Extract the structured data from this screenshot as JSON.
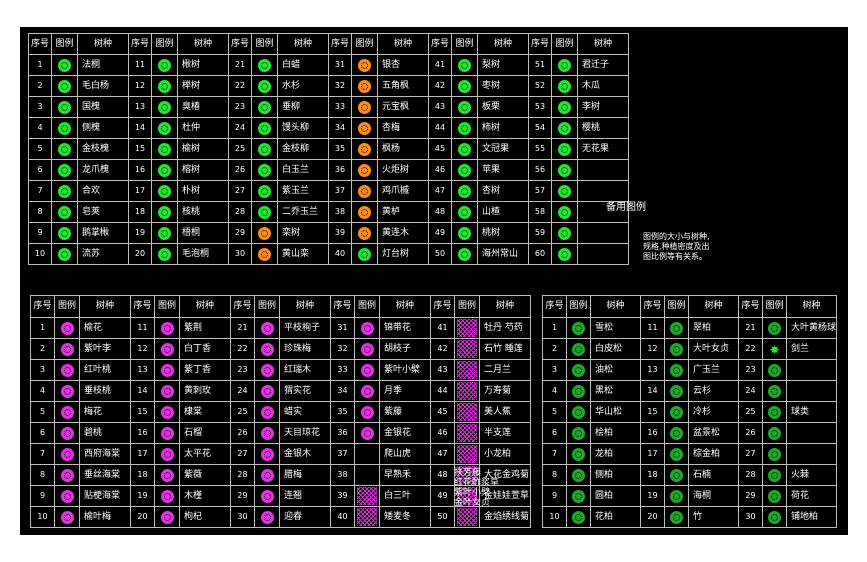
{
  "table1": {
    "headers": [
      "序号",
      "图例",
      "树种",
      "序号",
      "图例",
      "树种",
      "序号",
      "图例",
      "树种",
      "序号",
      "图例",
      "树种",
      "序号",
      "图例",
      "树种",
      "序号",
      "图例",
      "树种"
    ],
    "rows": [
      [
        "1",
        "g",
        "法桐",
        "11",
        "g",
        "楸树",
        "21",
        "g",
        "白蜡",
        "31",
        "o",
        "银杏",
        "41",
        "g",
        "梨树",
        "51",
        "g",
        "君迁子"
      ],
      [
        "2",
        "g",
        "毛白杨",
        "12",
        "g",
        "榉树",
        "22",
        "g",
        "水杉",
        "32",
        "o",
        "五角枫",
        "42",
        "g",
        "枣树",
        "52",
        "g",
        "木瓜"
      ],
      [
        "3",
        "g",
        "国槐",
        "13",
        "g",
        "臭椿",
        "23",
        "g",
        "垂柳",
        "33",
        "o",
        "元宝枫",
        "43",
        "g",
        "板栗",
        "53",
        "g",
        "李树"
      ],
      [
        "4",
        "g",
        "侧槐",
        "14",
        "g",
        "杜仲",
        "24",
        "g",
        "馒头柳",
        "34",
        "o",
        "杏梅",
        "44",
        "g",
        "柿树",
        "54",
        "g",
        "樱桃"
      ],
      [
        "5",
        "g",
        "金枝槐",
        "15",
        "g",
        "榆树",
        "25",
        "g",
        "金枝柳",
        "35",
        "o",
        "枫杨",
        "45",
        "g",
        "文冠果",
        "55",
        "g",
        "无花果"
      ],
      [
        "6",
        "g",
        "龙爪槐",
        "16",
        "g",
        "榕树",
        "26",
        "g",
        "白玉兰",
        "36",
        "o",
        "火炬树",
        "46",
        "g",
        "苹果",
        "56",
        "g",
        ""
      ],
      [
        "7",
        "g",
        "合欢",
        "17",
        "g",
        "朴树",
        "27",
        "g",
        "紫玉兰",
        "37",
        "o",
        "鸡爪槭",
        "47",
        "g",
        "杏树",
        "57",
        "g",
        ""
      ],
      [
        "8",
        "g",
        "皂荚",
        "18",
        "g",
        "核桃",
        "28",
        "g",
        "二乔玉兰",
        "38",
        "o",
        "黄栌",
        "48",
        "g",
        "山楂",
        "58",
        "g",
        ""
      ],
      [
        "9",
        "g",
        "鹅掌楸",
        "19",
        "g",
        "梧桐",
        "29",
        "o",
        "栾树",
        "39",
        "o",
        "黄连木",
        "49",
        "g",
        "桃树",
        "59",
        "g",
        ""
      ],
      [
        "10",
        "g",
        "流苏",
        "20",
        "g",
        "毛泡桐",
        "30",
        "o",
        "黄山栾",
        "40",
        "g",
        "灯台树",
        "50",
        "g",
        "海州常山",
        "60",
        "g",
        ""
      ]
    ]
  },
  "notes": {
    "title": "备用图例",
    "lines": [
      "图例的大小与树种,",
      "规格,种植密度及出",
      "图比例等有关系。"
    ]
  },
  "table2": {
    "headers": [
      "序号",
      "图例",
      "树种",
      "序号",
      "图例",
      "树种",
      "序号",
      "图例",
      "树种",
      "序号",
      "图例",
      "树种",
      "序号",
      "图例",
      "树种"
    ],
    "rows": [
      [
        "1",
        "m",
        "榆花",
        "11",
        "m",
        "紫荆",
        "21",
        "m",
        "平枝栒子",
        "31",
        "m",
        "锦带花",
        "41",
        "hatch",
        "牡丹 芍药"
      ],
      [
        "2",
        "m",
        "紫叶李",
        "12",
        "m",
        "白丁香",
        "22",
        "m",
        "珍珠梅",
        "32",
        "m",
        "胡枝子",
        "42",
        "hatch",
        "石竹 睡莲"
      ],
      [
        "3",
        "m",
        "红叶桃",
        "13",
        "m",
        "紫丁香",
        "23",
        "m",
        "红瑞木",
        "33",
        "m",
        "紫叶小檗",
        "43",
        "hatch",
        "二月兰"
      ],
      [
        "4",
        "m",
        "垂枝桃",
        "14",
        "m",
        "黄刺玫",
        "24",
        "m",
        "猬实花",
        "34",
        "m",
        "月季",
        "44",
        "hatch",
        "万寿菊"
      ],
      [
        "5",
        "m",
        "梅花",
        "15",
        "m",
        "棣棠",
        "25",
        "m",
        "蜡实",
        "35",
        "m",
        "紫藤",
        "45",
        "hatch",
        "美人蕉"
      ],
      [
        "6",
        "m",
        "碧桃",
        "16",
        "m",
        "石榴",
        "26",
        "m",
        "天目琼花",
        "36",
        "m",
        "金银花",
        "46",
        "hatch",
        "半支莲"
      ],
      [
        "7",
        "m",
        "西府海棠",
        "17",
        "m",
        "太平花",
        "27",
        "m",
        "金银木",
        "37",
        "",
        "爬山虎",
        "47",
        "hatch",
        "小龙柏"
      ],
      [
        "8",
        "m",
        "垂丝海棠",
        "18",
        "m",
        "紫薇",
        "28",
        "m",
        "腊梅",
        "38",
        "",
        "早熟禾",
        "48",
        "hatch",
        "大花金鸡菊"
      ],
      [
        "9",
        "m",
        "贴梗海棠",
        "19",
        "m",
        "木槿",
        "29",
        "m",
        "连翘",
        "39",
        "hatch",
        "白三叶",
        "49",
        "hatch",
        "金娃娃萱草"
      ],
      [
        "10",
        "m",
        "榆叶梅",
        "20",
        "m",
        "枸杞",
        "30",
        "m",
        "迎春",
        "40",
        "hatch",
        "矮麦冬",
        "50",
        "hatch",
        "金焰绣线菊"
      ]
    ],
    "extra_lines": [
      "扶芳藤",
      "红花酢浆草",
      "紫叶小檗",
      "金叶女贞"
    ]
  },
  "table3": {
    "headers": [
      "序号",
      "图例",
      "树种",
      "序号",
      "图例",
      "树种",
      "序号",
      "图例",
      "树种"
    ],
    "rows": [
      [
        "1",
        "d",
        "雪松",
        "11",
        "d",
        "翠柏",
        "21",
        "d",
        "大叶黄杨球"
      ],
      [
        "2",
        "d",
        "白皮松",
        "12",
        "d",
        "大叶女贞",
        "22",
        "star",
        "剑兰"
      ],
      [
        "3",
        "d",
        "油松",
        "13",
        "d",
        "广玉兰",
        "23",
        "d",
        ""
      ],
      [
        "4",
        "d",
        "黑松",
        "14",
        "d",
        "云杉",
        "24",
        "d",
        ""
      ],
      [
        "5",
        "d",
        "华山松",
        "15",
        "d",
        "冷杉",
        "25",
        "d",
        "球类"
      ],
      [
        "6",
        "d",
        "桧柏",
        "16",
        "d",
        "盆景松",
        "26",
        "d",
        ""
      ],
      [
        "7",
        "d",
        "龙柏",
        "17",
        "d",
        "棕金柏",
        "27",
        "d",
        ""
      ],
      [
        "8",
        "d",
        "侧柏",
        "18",
        "d",
        "石楠",
        "28",
        "d",
        "火棘"
      ],
      [
        "9",
        "d",
        "圆柏",
        "19",
        "d",
        "海桐",
        "29",
        "d",
        "荷花"
      ],
      [
        "10",
        "d",
        "花柏",
        "20",
        "d",
        "竹",
        "30",
        "d",
        "铺地柏"
      ]
    ]
  }
}
